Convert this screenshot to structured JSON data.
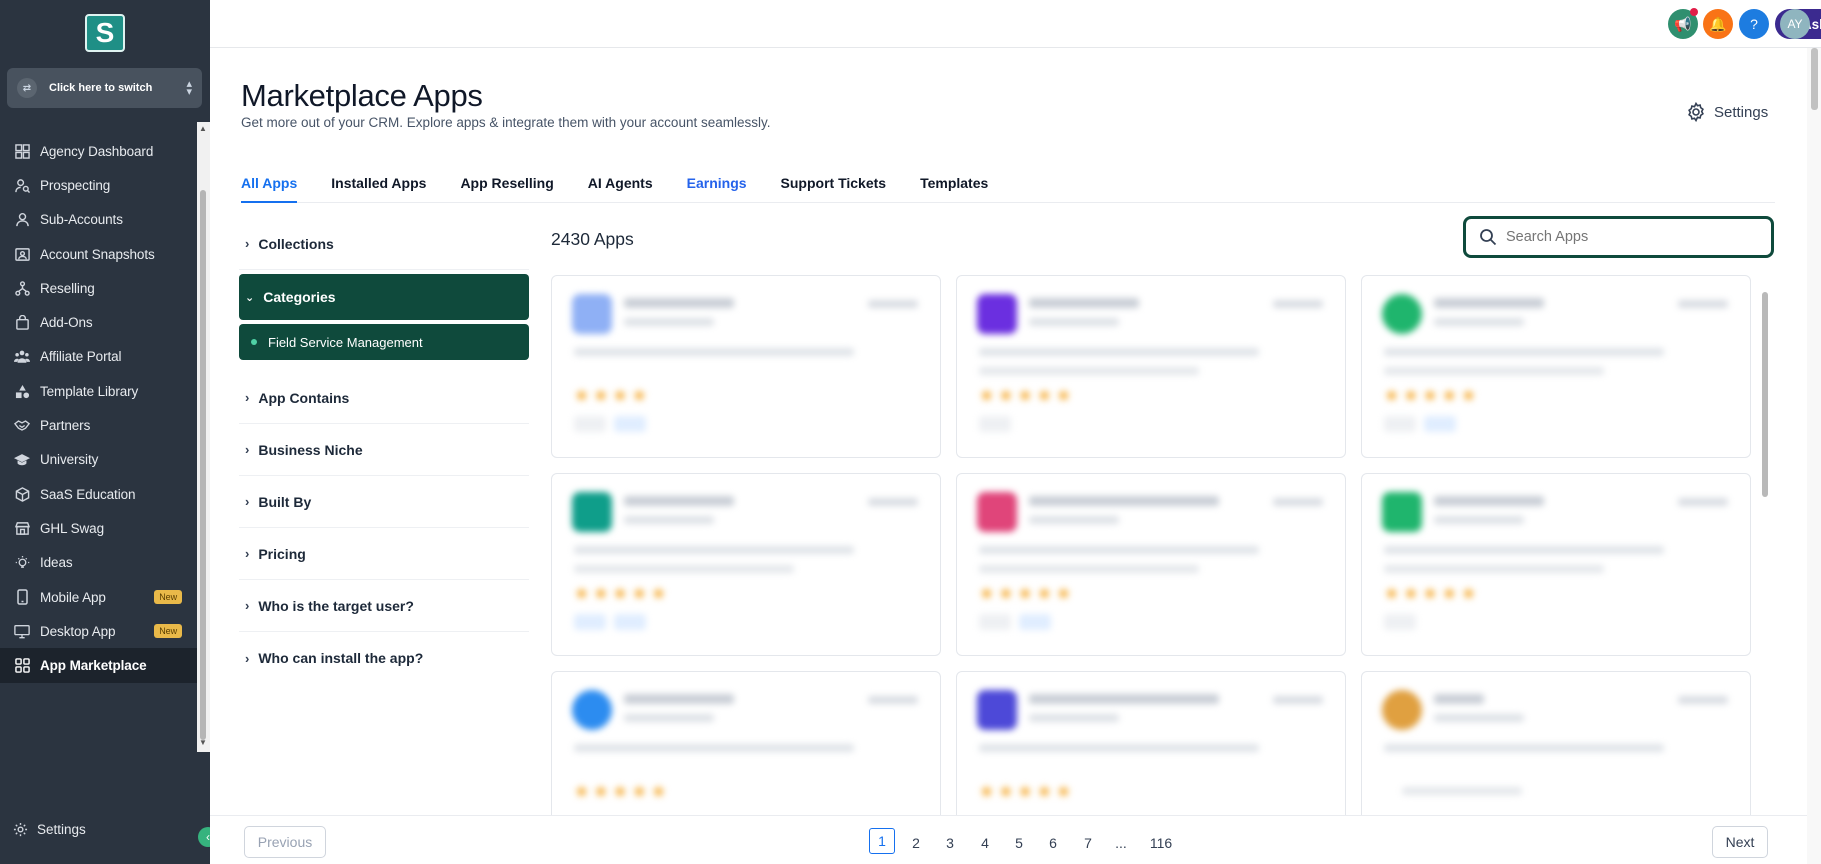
{
  "sidebar": {
    "logo_letter": "S",
    "switcher_label": "Click here to switch",
    "items": [
      {
        "label": "Agency Dashboard",
        "icon": "dashboard-icon"
      },
      {
        "label": "Prospecting",
        "icon": "user-search-icon"
      },
      {
        "label": "Sub-Accounts",
        "icon": "user-icon"
      },
      {
        "label": "Account Snapshots",
        "icon": "snapshot-icon"
      },
      {
        "label": "Reselling",
        "icon": "reselling-icon"
      },
      {
        "label": "Add-Ons",
        "icon": "bag-icon"
      },
      {
        "label": "Affiliate Portal",
        "icon": "users-icon"
      },
      {
        "label": "Template Library",
        "icon": "shapes-icon"
      },
      {
        "label": "Partners",
        "icon": "handshake-icon"
      },
      {
        "label": "University",
        "icon": "graduation-cap-icon"
      },
      {
        "label": "SaaS Education",
        "icon": "box-icon"
      },
      {
        "label": "GHL Swag",
        "icon": "store-icon"
      },
      {
        "label": "Ideas",
        "icon": "lightbulb-icon"
      },
      {
        "label": "Mobile App",
        "icon": "mobile-icon",
        "badge": "New"
      },
      {
        "label": "Desktop App",
        "icon": "desktop-icon",
        "badge": "New"
      },
      {
        "label": "App Marketplace",
        "icon": "grid-icon",
        "active": true
      }
    ],
    "settings_label": "Settings"
  },
  "topbar": {
    "ask_ai_label": "Ask AI",
    "help_label": "?",
    "avatar_initials": "AY"
  },
  "header": {
    "title": "Marketplace Apps",
    "subtitle": "Get more out of your CRM. Explore apps & integrate them with your account seamlessly.",
    "settings_label": "Settings"
  },
  "tabs": [
    {
      "label": "All Apps",
      "active": true
    },
    {
      "label": "Installed Apps"
    },
    {
      "label": "App Reselling"
    },
    {
      "label": "AI Agents"
    },
    {
      "label": "Earnings"
    },
    {
      "label": "Support Tickets"
    },
    {
      "label": "Templates"
    }
  ],
  "filters": {
    "collections": "Collections",
    "categories": "Categories",
    "selected_category": "Field Service Management",
    "app_contains": "App Contains",
    "business_niche": "Business Niche",
    "built_by": "Built By",
    "pricing": "Pricing",
    "target_user": "Who is the target user?",
    "who_can_install": "Who can install the app?"
  },
  "apps": {
    "count_label": "2430 Apps",
    "search_placeholder": "Search Apps",
    "card_logo_colors": [
      "#8fb0f5",
      "#6b2fe0",
      "#1fb56d",
      "#0f9e8a",
      "#e0457a",
      "#1fb56d",
      "#2c8cf0",
      "#4d49d8",
      "#e0a040"
    ]
  },
  "pagination": {
    "previous_label": "Previous",
    "next_label": "Next",
    "pages": [
      "1",
      "2",
      "3",
      "4",
      "5",
      "6",
      "7",
      "...",
      "116"
    ],
    "current": "1"
  },
  "colors": {
    "sidebar_bg": "#2b3440",
    "accent_green": "#0f4a3c",
    "tab_active": "#1570ef"
  }
}
